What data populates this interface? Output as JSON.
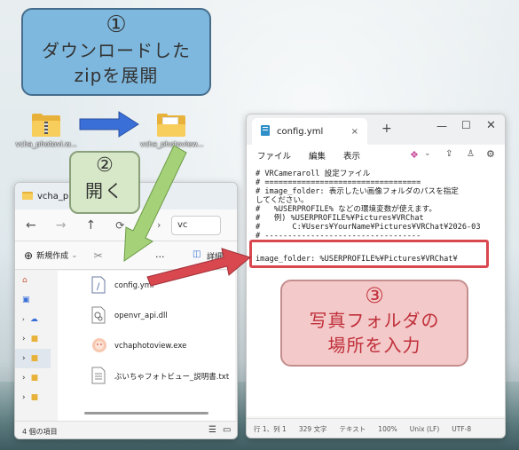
{
  "callouts": {
    "step1": {
      "number": "①",
      "line1": "ダウンロードした",
      "line2": "zipを展開"
    },
    "step2": {
      "number": "②",
      "text": "開く"
    },
    "step3": {
      "number": "③",
      "line1": "写真フォルダの",
      "line2": "場所を入力"
    }
  },
  "desktop": {
    "folder_left_label": "vcha_photovi.w...",
    "folder_right_label": "vcha_photoview..."
  },
  "explorer": {
    "tab_title": "vcha_pho",
    "address_text": "vc",
    "toolbar": {
      "new_label": "新規作成",
      "detail_label": "詳細",
      "more_label": "..."
    },
    "files": [
      {
        "name": "config.yml",
        "icon": "text-file-icon"
      },
      {
        "name": "openvr_api.dll",
        "icon": "dll-file-icon"
      },
      {
        "name": "vchaphotoview.exe",
        "icon": "app-exe-icon"
      },
      {
        "name": "ぶいちゃフォトビュー_説明書.txt",
        "icon": "text-file-icon"
      }
    ],
    "status": "4 個の項目"
  },
  "notepad": {
    "tab_title": "config.yml",
    "menu": {
      "file": "ファイル",
      "edit": "編集",
      "view": "表示"
    },
    "code_lines": [
      "# VRCameraroll 設定ファイル",
      "# ==================================",
      "# image_folder: 表示したい画像フォルダのパスを指定",
      "してください。",
      "#   %USERPROFILE% などの環境変数が使えます。",
      "#   例) %USERPROFILE%¥Pictures¥VRChat",
      "#       C:¥Users¥YourName¥Pictures¥VRChat¥2026-03",
      "# ----------------------------------",
      "",
      "image_folder: %USERPROFILE%¥Pictures¥VRChat¥"
    ],
    "status": {
      "position": "行 1、列 1",
      "chars": "329 文字",
      "type": "テキスト",
      "zoom": "100%",
      "eol": "Unix (LF)",
      "encoding": "UTF-8"
    }
  },
  "colors": {
    "arrow_blue": "#3a6fd8",
    "arrow_green": "#9acb6b",
    "arrow_red": "#d9474f",
    "highlight": "#d9474f"
  }
}
